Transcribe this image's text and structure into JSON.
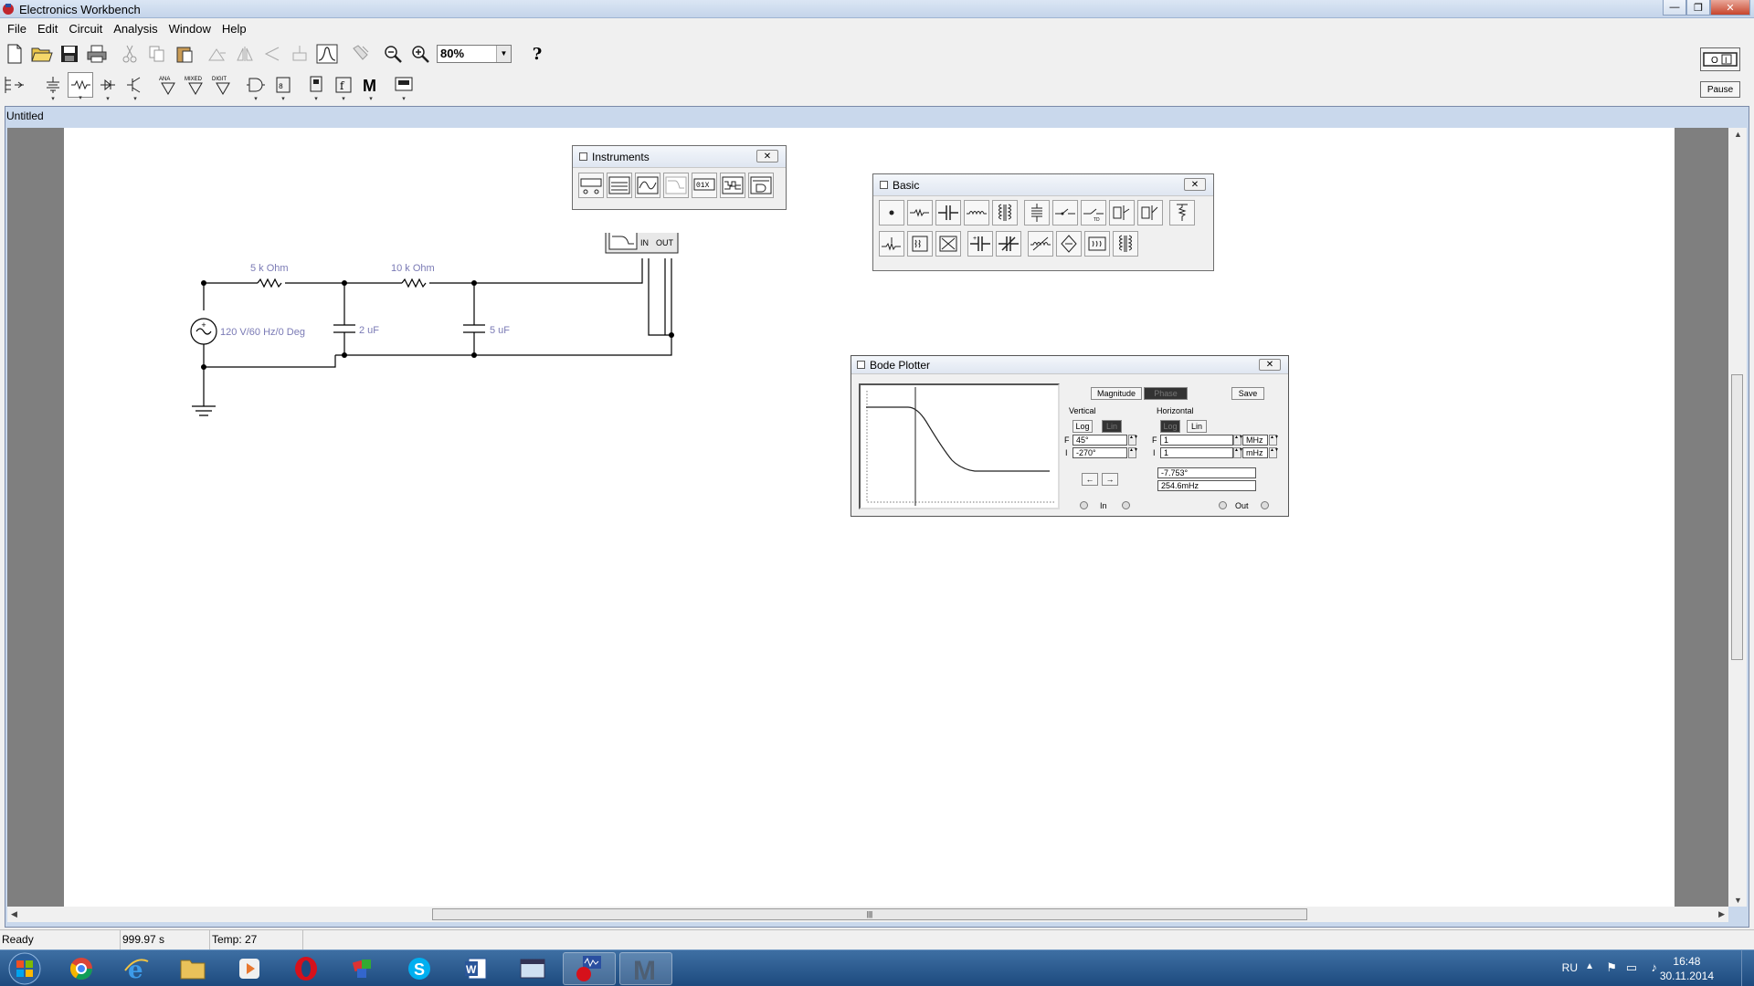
{
  "window": {
    "title": "Electronics Workbench"
  },
  "menu": [
    "File",
    "Edit",
    "Circuit",
    "Analysis",
    "Window",
    "Help"
  ],
  "toolbar": {
    "zoom": "80%",
    "help": "?",
    "pause_label": "Pause"
  },
  "toolbar2_labels": {
    "analog": "ANA",
    "mixed": "MIXED",
    "digital": "DIGIT",
    "m": "M"
  },
  "document": {
    "title": "Untitled"
  },
  "instruments_palette": {
    "title": "Instruments"
  },
  "basic_palette": {
    "title": "Basic"
  },
  "circuit": {
    "r1": "5 k Ohm",
    "r2": "10 k Ohm",
    "source": "120 V/60 Hz/0 Deg",
    "c1": "2 uF",
    "c2": "5 uF",
    "bode_in": "IN",
    "bode_out": "OUT"
  },
  "bode": {
    "title": "Bode Plotter",
    "magnitude": "Magnitude",
    "phase": "Phase",
    "save": "Save",
    "vertical": "Vertical",
    "horizontal": "Horizontal",
    "log": "Log",
    "lin": "Lin",
    "f_label": "F",
    "i_label": "I",
    "v_final": "45°",
    "v_initial": "-270°",
    "h_final": "1",
    "h_initial": "1",
    "h_final_unit": "MHz",
    "h_initial_unit": "mHz",
    "readout_value": "-7.753°",
    "readout_freq": "254.6mHz",
    "in_label": "In",
    "out_label": "Out",
    "left_arrow": "←",
    "right_arrow": "→"
  },
  "status": {
    "state": "Ready",
    "time": "999.97 s",
    "temp": "Temp: 27"
  },
  "taskbar": {
    "lang": "RU",
    "time": "16:48",
    "date": "30.11.2014"
  }
}
